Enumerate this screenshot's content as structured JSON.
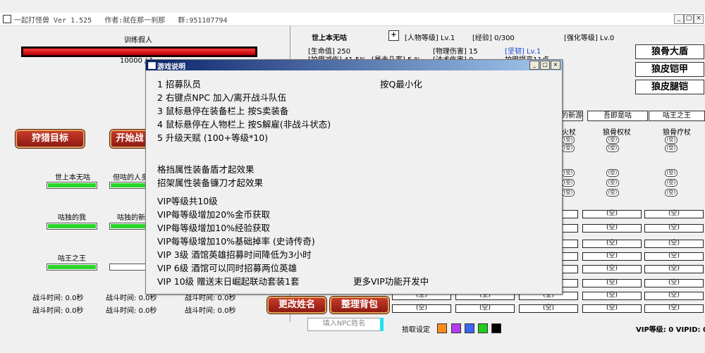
{
  "window": {
    "title": "一起打怪兽 Ver 1.525   作者:就在那一刹那   群:951107794",
    "min": "_",
    "max": "□",
    "close": "×"
  },
  "boss": {
    "name": "训练假人",
    "hp_text": "10000 / 1",
    "hp_ratio": 1.0
  },
  "hunt_button": "狩猎目标",
  "start_button": "开始战",
  "party": [
    {
      "name": "世上本无咕",
      "hp": 1.0
    },
    {
      "name": "但咕的人多",
      "hp": 1.0
    },
    {
      "name": "咕独的我",
      "hp": 1.0
    },
    {
      "name": "咕独的新",
      "hp": 1.0
    },
    {
      "name": "咕王之王",
      "hp": 1.0
    },
    {
      "name": "",
      "hp": 0.0
    }
  ],
  "battle_times": [
    "战斗时间: 0.0秒",
    "战斗时间: 0.0秒",
    "战斗时间: 0.0秒",
    "战斗时间: 0.0秒",
    "战斗时间: 0.0秒",
    "战斗时间: 0.0秒"
  ],
  "bottom": {
    "rename": "更改姓名",
    "sort": "整理背包",
    "npc_placeholder": "填入NPC姓名",
    "pickup_label": "拾取设定",
    "vip": "VIP等级: 0 VIPID: 0"
  },
  "pickup_colors": [
    "#ff8c1a",
    "#b63cf0",
    "#3a66f0",
    "#1fcc1f",
    "#000000"
  ],
  "character": {
    "name": "世上本无咕",
    "add": "+",
    "level_label": "[人物等级] Lv.1",
    "exp_label": "[经验] 0/300",
    "enhance_label": "[强化等级] Lv.0",
    "hp_label": "[生命值] 250",
    "phys_label": "[物理伤害] 15",
    "skill_label": "[坚韧] Lv.1",
    "block_label": "[护甲减伤] 41.5%",
    "crit_label": "[暴击几率] 5 %",
    "magic_label": "[法术伤害] 0",
    "dodge_label": "护甲提高11点"
  },
  "equip_buttons": [
    "狼骨大盾",
    "狼皮铠甲",
    "狼皮腿铠"
  ],
  "columns": [
    {
      "head": "的新游",
      "weapon": "火杖"
    },
    {
      "head": "吾即是咕",
      "weapon": "狼骨权杖"
    },
    {
      "head": "咕王之王",
      "weapon": "狼骨疗杖"
    }
  ],
  "empty_slot": "(空)",
  "dialog": {
    "title": "游戏说明",
    "lines": [
      "1 招募队员",
      "2 右键点NPC 加入/离开战斗队伍",
      "3 鼠标悬停在装备栏上 按S卖装备",
      "4 鼠标悬停在人物栏上 按S解雇(非战斗状态)",
      "5 升级天赋 (100+等级*10)",
      "格挡属性装备盾才起效果",
      "招架属性装备镰刀才起效果",
      "VIP等级共10级",
      "VIP每等级增加20%金币获取",
      "VIP每等级增加10%经验获取",
      "VIP每等级增加10%基础掉率 (史诗传奇)",
      "VIP 3级 酒馆英雄招募时间降低为3小时",
      "VIP 6级 酒馆可以同时招募两位英雄",
      "VIP 10级 赠送末日崛起联动套装1套"
    ],
    "hint_q": "按Q最小化",
    "more_vip": "更多VIP功能开发中"
  }
}
